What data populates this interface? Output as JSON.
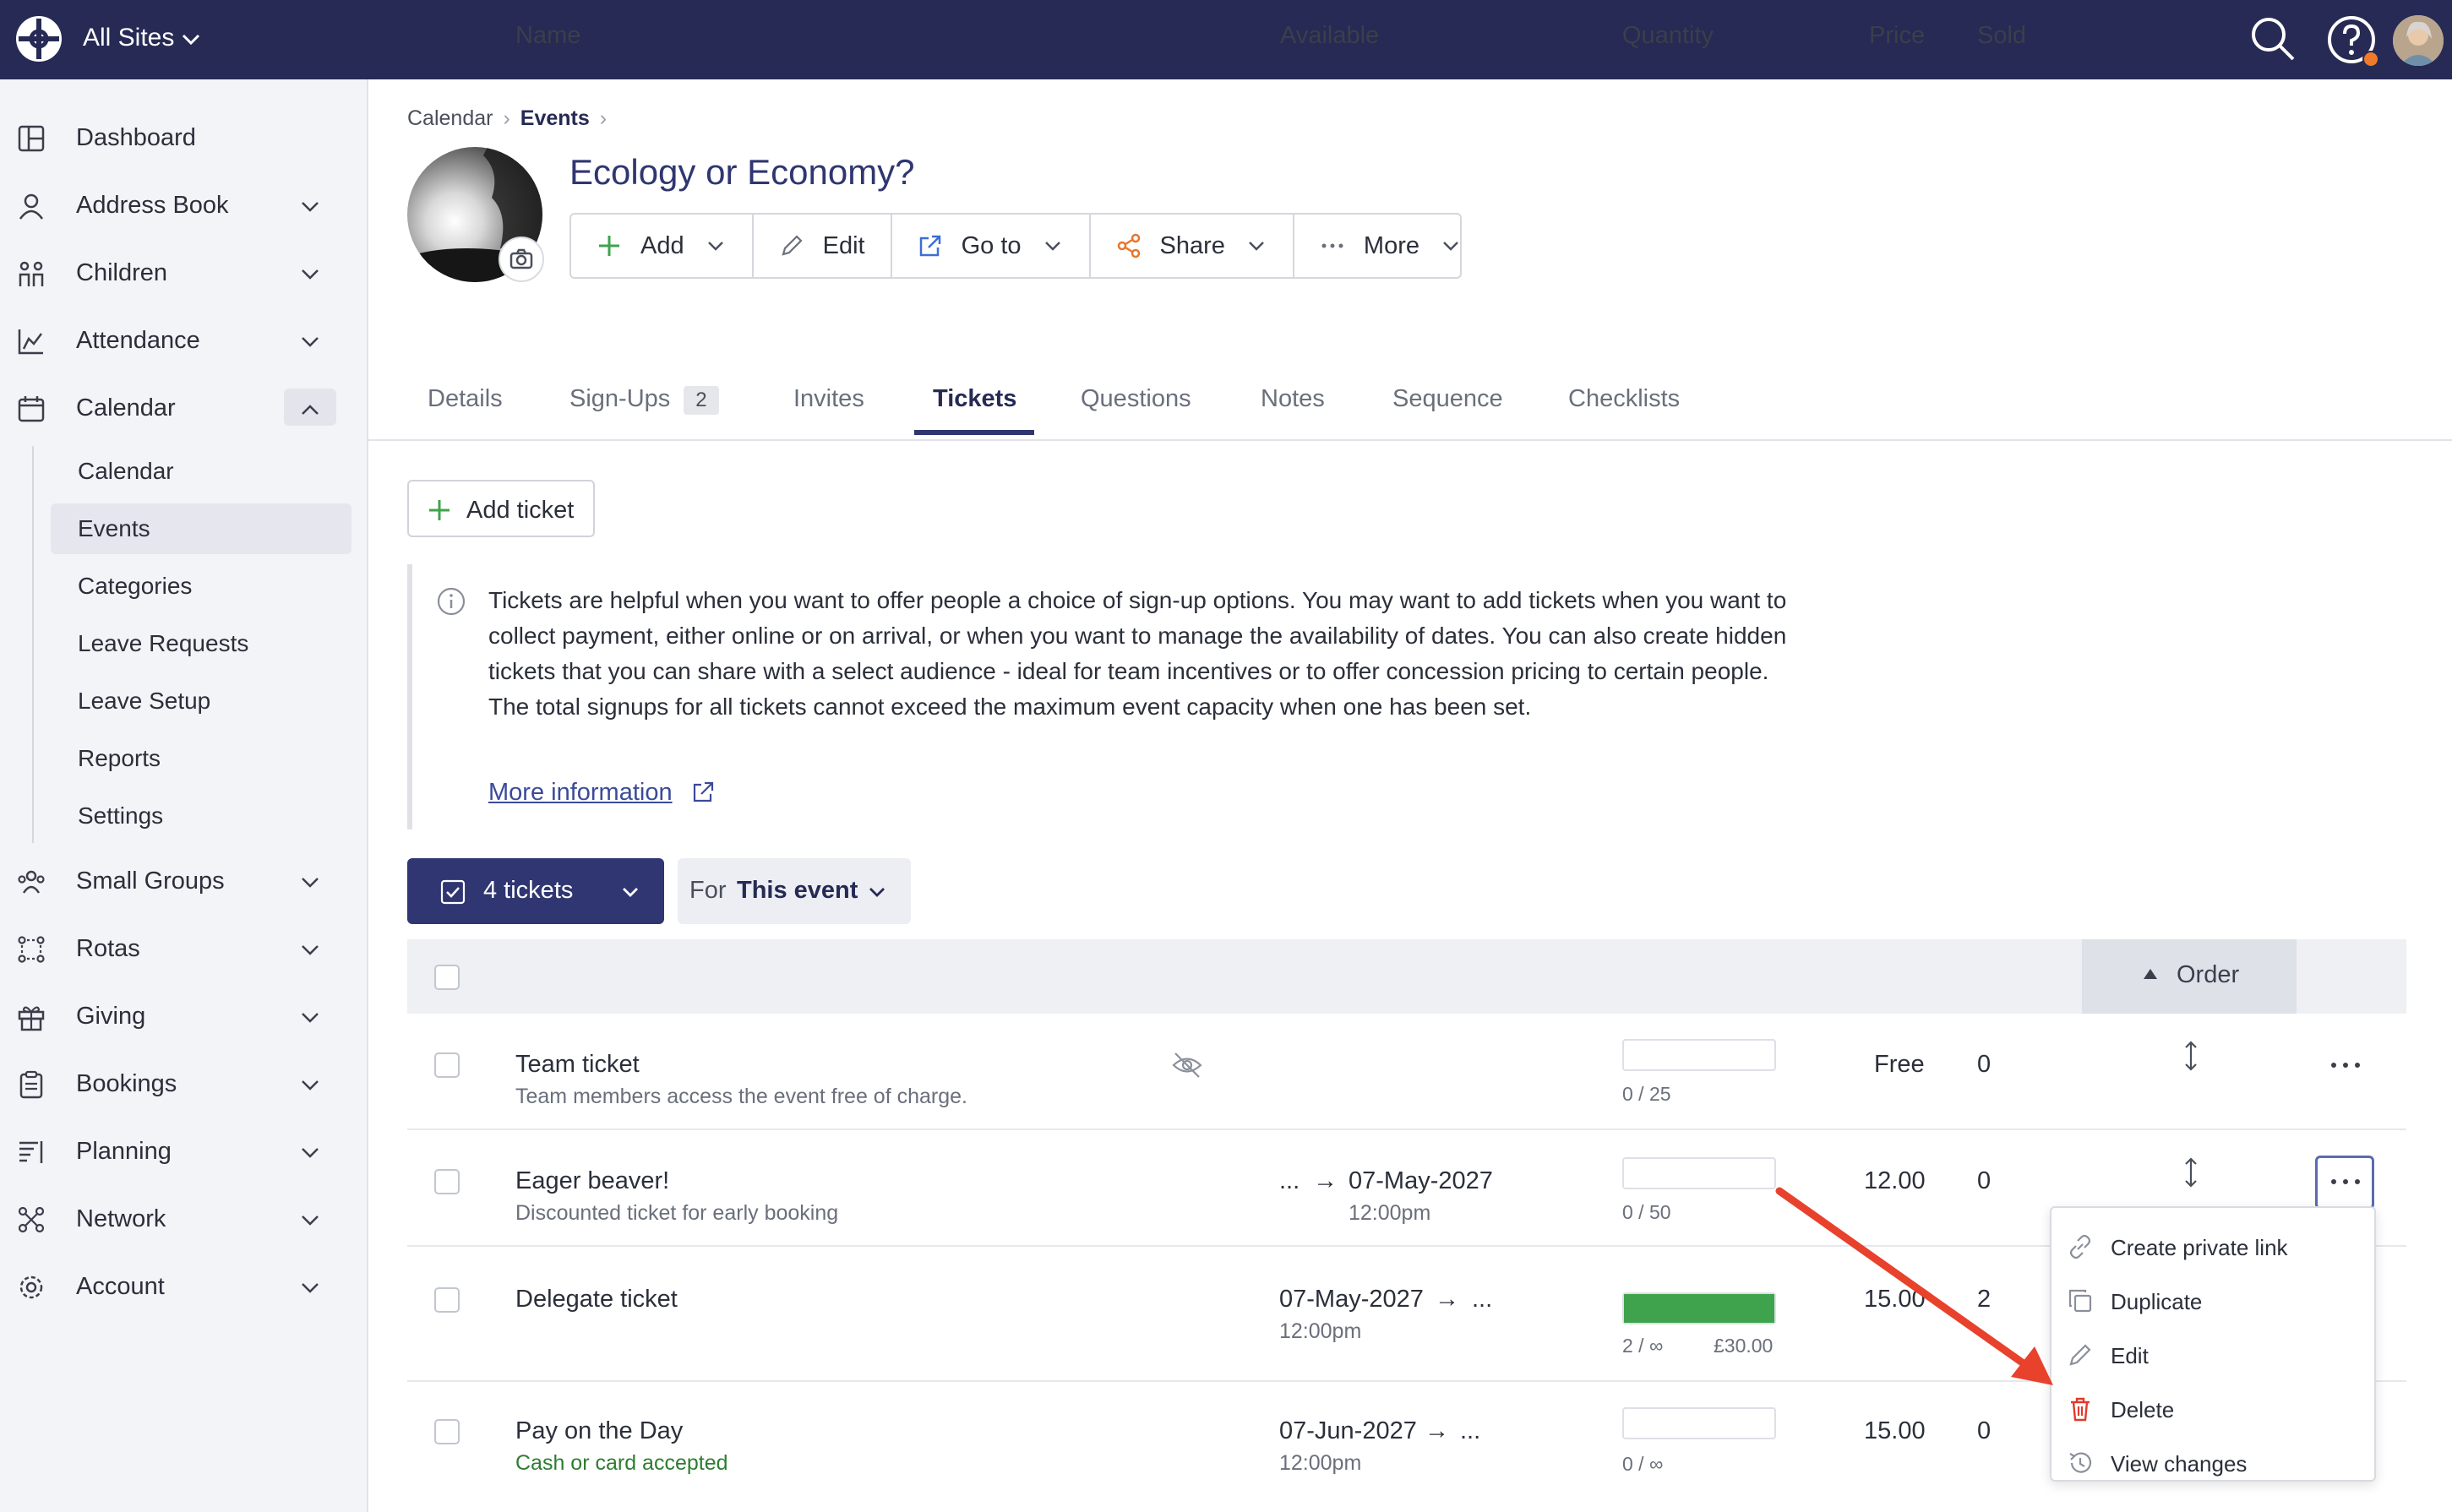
{
  "topbar": {
    "site_label": "All Sites",
    "colors": {
      "background": "#262a54",
      "notification": "#f07a2c"
    }
  },
  "sidebar": {
    "items": [
      {
        "label": "Dashboard",
        "icon": "dashboard-icon"
      },
      {
        "label": "Address Book",
        "icon": "person-icon"
      },
      {
        "label": "Children",
        "icon": "children-icon"
      },
      {
        "label": "Attendance",
        "icon": "chart-icon"
      },
      {
        "label": "Calendar",
        "icon": "calendar-icon"
      },
      {
        "label": "Small Groups",
        "icon": "group-icon"
      },
      {
        "label": "Rotas",
        "icon": "rotas-icon"
      },
      {
        "label": "Giving",
        "icon": "gift-icon"
      },
      {
        "label": "Bookings",
        "icon": "clipboard-icon"
      },
      {
        "label": "Planning",
        "icon": "planning-icon"
      },
      {
        "label": "Network",
        "icon": "network-icon"
      },
      {
        "label": "Account",
        "icon": "gear-icon"
      }
    ],
    "calendar_sub": [
      "Calendar",
      "Events",
      "Categories",
      "Leave Requests",
      "Leave Setup",
      "Reports",
      "Settings"
    ],
    "active_sub": "Events"
  },
  "breadcrumb": {
    "first": "Calendar",
    "second": "Events"
  },
  "event": {
    "title": "Ecology or Economy?"
  },
  "toolbar": {
    "add": "Add",
    "edit": "Edit",
    "goto": "Go to",
    "share": "Share",
    "more": "More"
  },
  "tabs": {
    "details": "Details",
    "signups": "Sign-Ups",
    "signups_count": "2",
    "invites": "Invites",
    "tickets": "Tickets",
    "questions": "Questions",
    "notes": "Notes",
    "sequence": "Sequence",
    "checklists": "Checklists"
  },
  "add_ticket": "Add ticket",
  "info": {
    "text": "Tickets are helpful when you want to offer people a choice of sign-up options. You may want to add tickets when you want to collect payment, either online or on arrival, or when you want to manage the availability of dates. You can also create hidden tickets that you can share with a select audience - ideal for team incentives or to offer concession pricing to certain people. The total signups for all tickets cannot exceed the maximum event capacity when one has been set.",
    "link": "More information"
  },
  "filters": {
    "tickets": "4 tickets",
    "for_label": "For",
    "for_value": "This event"
  },
  "table": {
    "headers": {
      "name": "Name",
      "available": "Available",
      "quantity": "Quantity",
      "price": "Price",
      "sold": "Sold",
      "order": "Order"
    },
    "rows": [
      {
        "name": "Team ticket",
        "desc": "Team members access the event free of charge.",
        "avail_from": "",
        "avail_to": "",
        "avail_time": "",
        "qty_text": "0 / 25",
        "qty_fill": 0,
        "price": "Free",
        "sold": "0"
      },
      {
        "name": "Eager beaver!",
        "desc": "Discounted ticket for early booking",
        "avail_from": "...",
        "avail_to": "07-May-2027",
        "avail_time": "12:00pm",
        "qty_text": "0 / 50",
        "qty_fill": 0,
        "price": "12.00",
        "sold": "0"
      },
      {
        "name": "Delegate ticket",
        "desc": "",
        "avail_from": "07-May-2027",
        "avail_to": "...",
        "avail_time": "12:00pm",
        "qty_text": "2 / ∞",
        "qty_extra": "£30.00",
        "qty_fill": 1,
        "price": "15.00",
        "sold": "2"
      },
      {
        "name": "Pay on the Day",
        "desc": "Cash or card accepted",
        "avail_from": "07-Jun-2027",
        "avail_to": "...",
        "avail_time": "12:00pm",
        "qty_text": "0 / ∞",
        "qty_fill": 0,
        "price": "15.00",
        "sold": "0"
      }
    ]
  },
  "menu": {
    "items": [
      "Create private link",
      "Duplicate",
      "Edit",
      "Delete",
      "View changes"
    ]
  },
  "annotation_color": "#e8412c"
}
